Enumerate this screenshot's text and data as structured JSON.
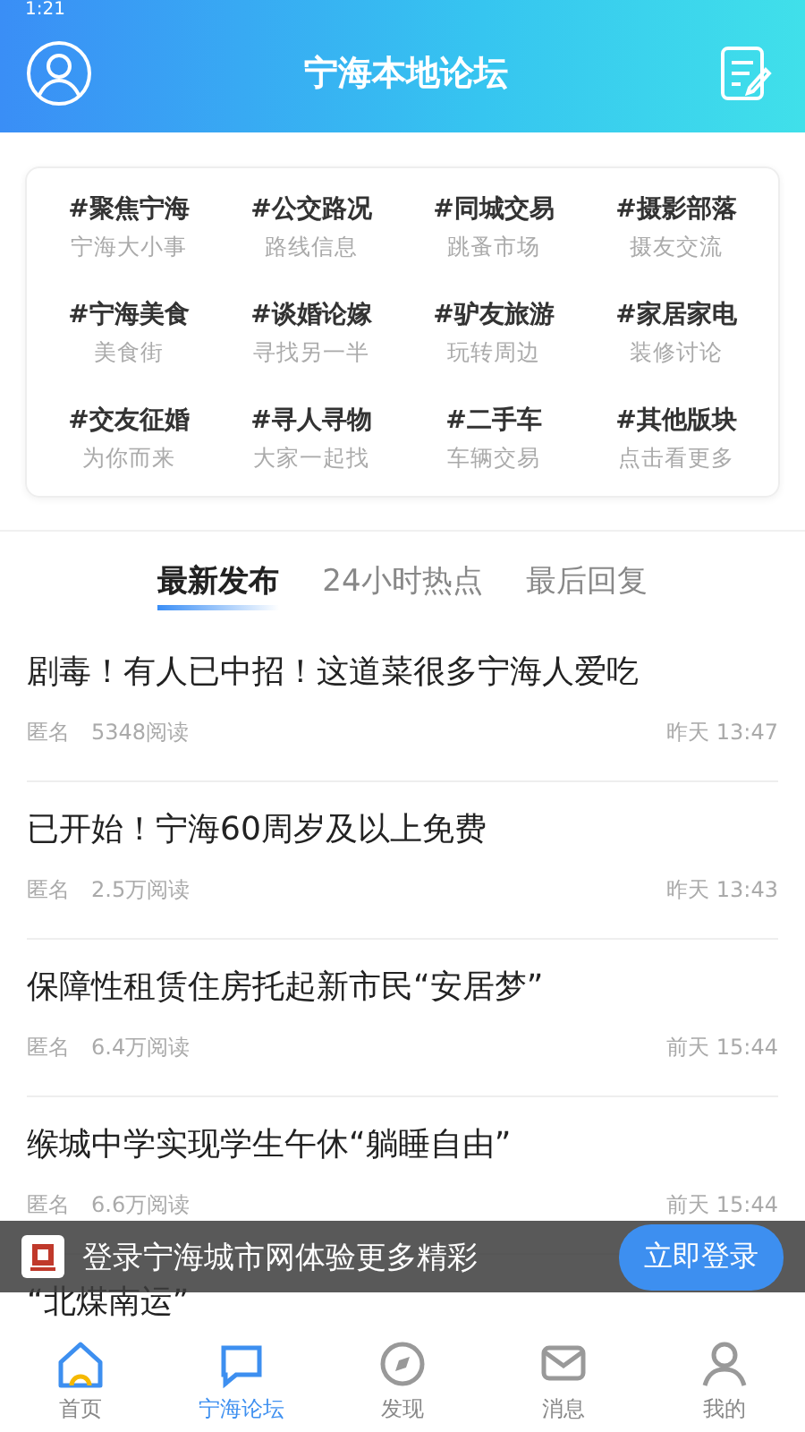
{
  "status_bar": {
    "time": "1:21"
  },
  "header": {
    "title": "宁海本地论坛"
  },
  "categories": [
    {
      "name": "#聚焦宁海",
      "desc": "宁海大小事"
    },
    {
      "name": "#公交路况",
      "desc": "路线信息"
    },
    {
      "name": "#同城交易",
      "desc": "跳蚤市场"
    },
    {
      "name": "#摄影部落",
      "desc": "摄友交流"
    },
    {
      "name": "#宁海美食",
      "desc": "美食街"
    },
    {
      "name": "#谈婚论嫁",
      "desc": "寻找另一半"
    },
    {
      "name": "#驴友旅游",
      "desc": "玩转周边"
    },
    {
      "name": "#家居家电",
      "desc": "装修讨论"
    },
    {
      "name": "#交友征婚",
      "desc": "为你而来"
    },
    {
      "name": "#寻人寻物",
      "desc": "大家一起找"
    },
    {
      "name": "#二手车",
      "desc": "车辆交易"
    },
    {
      "name": "#其他版块",
      "desc": "点击看更多"
    }
  ],
  "tabs": [
    {
      "label": "最新发布",
      "selected": true
    },
    {
      "label": "24小时热点",
      "selected": false
    },
    {
      "label": "最后回复",
      "selected": false
    }
  ],
  "posts": [
    {
      "title": "剧毒！有人已中招！这道菜很多宁海人爱吃",
      "author": "匿名",
      "reads": "5348阅读",
      "time": "昨天 13:47"
    },
    {
      "title": "已开始！宁海60周岁及以上免费",
      "author": "匿名",
      "reads": "2.5万阅读",
      "time": "昨天 13:43"
    },
    {
      "title": "保障性租赁住房托起新市民“安居梦”",
      "author": "匿名",
      "reads": "6.4万阅读",
      "time": "前天 15:44"
    },
    {
      "title": "缑城中学实现学生午休“躺睡自由”",
      "author": "匿名",
      "reads": "6.6万阅读",
      "time": "前天 15:44"
    },
    {
      "title": "“北煤南运”"
    }
  ],
  "login_banner": {
    "text": "登录宁海城市网体验更多精彩",
    "button": "立即登录"
  },
  "nav": [
    {
      "label": "首页",
      "selected": false
    },
    {
      "label": "宁海论坛",
      "selected": true
    },
    {
      "label": "发现",
      "selected": false
    },
    {
      "label": "消息",
      "selected": false
    },
    {
      "label": "我的",
      "selected": false
    }
  ]
}
